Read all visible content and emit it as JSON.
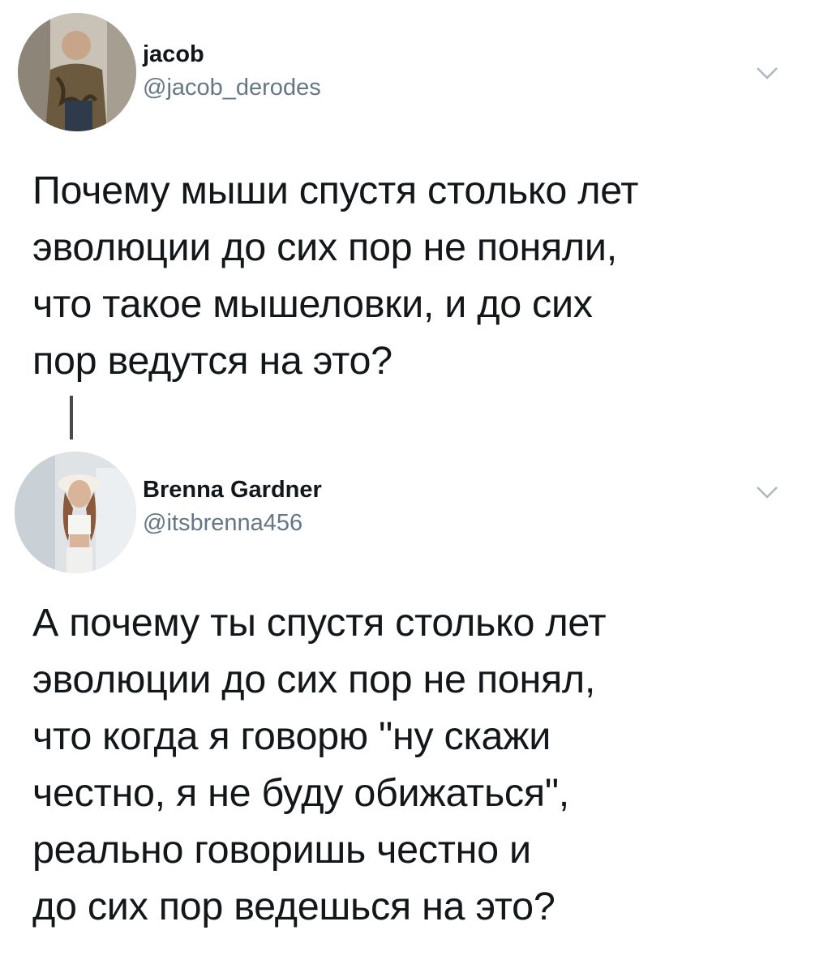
{
  "tweets": [
    {
      "display_name": "jacob",
      "handle": "@jacob_derodes",
      "text": "Почему мыши спустя столько лет\nэволюции до сих пор не поняли,\nчто такое мышеловки, и до сих\nпор ведутся на это?",
      "avatar_icon": "avatar-photo-jacob",
      "menu_icon": "chevron-down-icon"
    },
    {
      "display_name": "Brenna Gardner",
      "handle": "@itsbrenna456",
      "text": "А почему ты спустя столько лет\nэволюции до сих пор не понял,\nчто когда я говорю \"ну скажи\nчестно, я не буду обижаться\",\nреально говоришь честно и\nдо сих пор ведешься на это?",
      "avatar_icon": "avatar-photo-brenna",
      "menu_icon": "chevron-down-icon"
    }
  ],
  "colors": {
    "text": "#14171a",
    "handle": "#657786",
    "chevron": "#aab8c2",
    "thread_line": "#4a4a4a"
  }
}
